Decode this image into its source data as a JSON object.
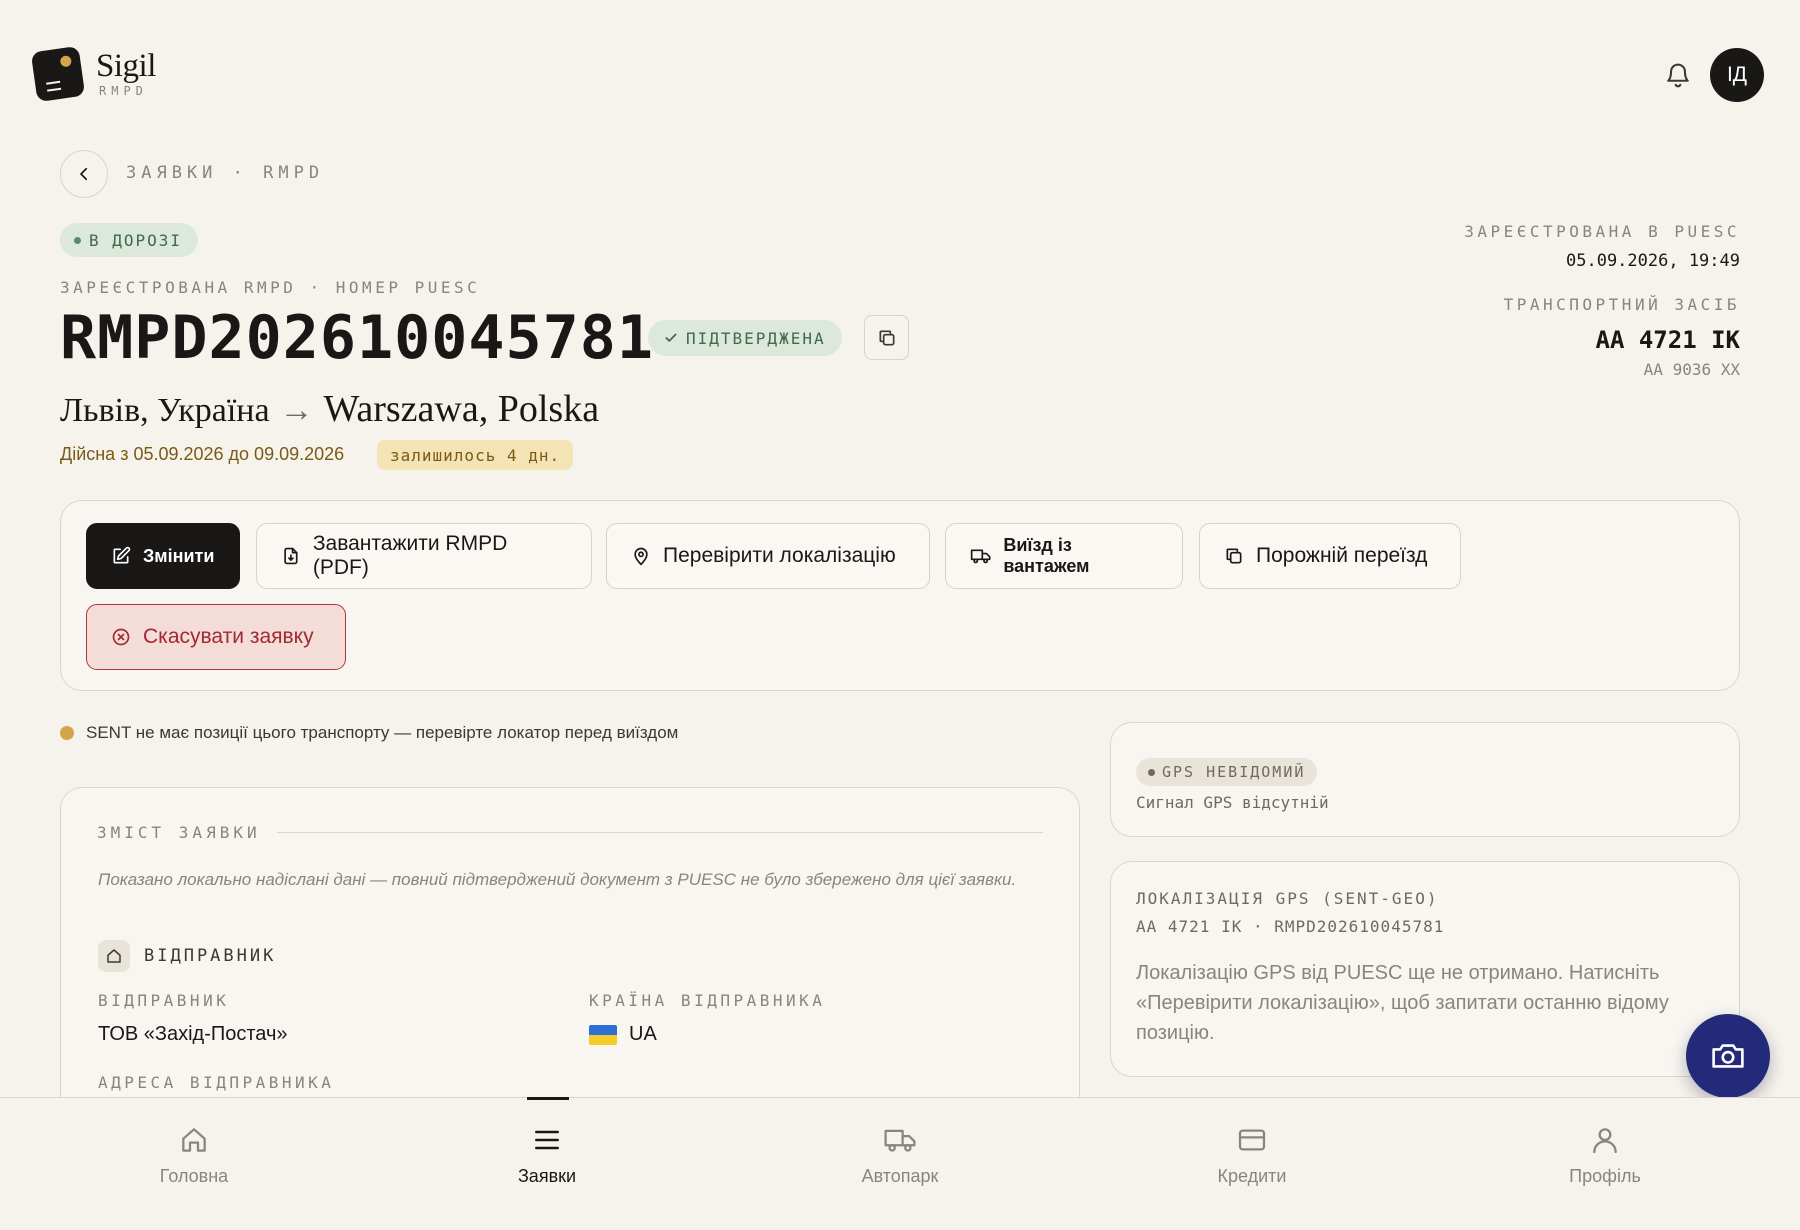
{
  "app": {
    "name": "Sigil",
    "sub": "RMPD"
  },
  "header": {
    "avatar_initials": "ІД"
  },
  "breadcrumb": "ЗАЯВКИ · RMPD",
  "status": {
    "label": "В ДОРОЗІ",
    "color": "#3f6b4a"
  },
  "doc": {
    "number_label": "ЗАРЕЄСТРОВАНА RMPD · НОМЕР PUESC",
    "number": "RMPD202610045781",
    "confirmed": "ПІДТВЕРДЖЕНА",
    "route_from": "Львів, Україна",
    "route_arrow": "→",
    "route_to": "Warszawa, Polska",
    "validity": "Дійсна з 05.09.2026 до 09.09.2026",
    "remaining": "залишилось 4 дн."
  },
  "meta": {
    "registered_label": "ЗАРЕЄСТРОВАНА В PUESC",
    "registered_value": "05.09.2026, 19:49",
    "vehicle_label": "ТРАНСПОРТНИЙ ЗАСІБ",
    "vehicle_plate": "AA 4721 IK",
    "trailer_plate": "AA 9036 XX"
  },
  "actions": {
    "edit": "Змінити",
    "download": "Завантажити RMPD (PDF)",
    "check_location": "Перевірити локалізацію",
    "exit_loaded": "Виїзд із вантажем",
    "empty_run": "Порожній переїзд",
    "cancel": "Скасувати заявку"
  },
  "warning": "SENT не має позиції цього транспорту — перевірте локатор перед виїздом",
  "content": {
    "title": "ЗМІСТ ЗАЯВКИ",
    "note": "Показано локально надіслані дані — повний підтверджений документ з PUESC не було збережено для цієї заявки.",
    "sender_section": "ВІДПРАВНИК",
    "sender_label": "ВІДПРАВНИК",
    "sender_value": "ТОВ «Захід-Постач»",
    "country_label": "КРАЇНА ВІДПРАВНИКА",
    "country_value": "UA",
    "address_label": "АДРЕСА ВІДПРАВНИКА"
  },
  "gps": {
    "status": "GPS НЕВІДОМИЙ",
    "sub": "Сигнал GPS відсутній"
  },
  "location": {
    "title": "ЛОКАЛІЗАЦІЯ GPS (SENT-GEO)",
    "subtitle": "AA 4721 IK · RMPD202610045781",
    "body": "Локалізацію GPS від PUESC ще не отримано. Натисніть «Перевірити локалізацію», щоб запитати останню відому позицію."
  },
  "nav": {
    "home": "Головна",
    "requests": "Заявки",
    "fleet": "Автопарк",
    "credits": "Кредити",
    "profile": "Профіль"
  },
  "colors": {
    "fab": "#232a7a",
    "accent_warn": "#d4a54a",
    "danger": "#b5343a"
  }
}
